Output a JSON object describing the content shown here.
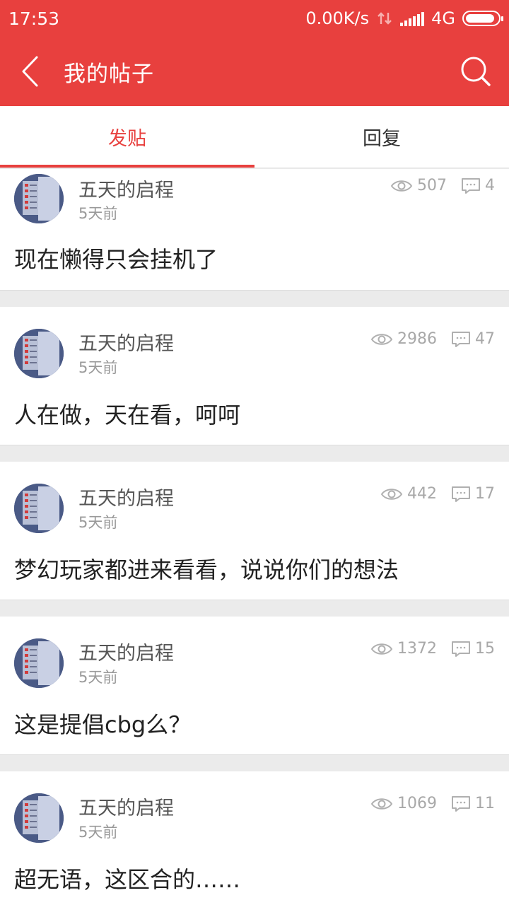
{
  "status_bar": {
    "time": "17:53",
    "net_speed": "0.00K/s",
    "network": "4G",
    "battery_level": 0.9
  },
  "header": {
    "back_icon": "chevron-left-icon",
    "title": "我的帖子",
    "search_icon": "search-icon",
    "background_color": "#e8403e"
  },
  "tabs": [
    {
      "label": "发贴",
      "active": true
    },
    {
      "label": "回复",
      "active": false
    }
  ],
  "posts": [
    {
      "author": "五天的启程",
      "time": "5天前",
      "views": "507",
      "comments": "4",
      "title": "现在懒得只会挂机了"
    },
    {
      "author": "五天的启程",
      "time": "5天前",
      "views": "2986",
      "comments": "47",
      "title": "人在做，天在看，呵呵"
    },
    {
      "author": "五天的启程",
      "time": "5天前",
      "views": "442",
      "comments": "17",
      "title": "梦幻玩家都进来看看，说说你们的想法"
    },
    {
      "author": "五天的启程",
      "time": "5天前",
      "views": "1372",
      "comments": "15",
      "title": "这是提倡cbg么？"
    },
    {
      "author": "五天的启程",
      "time": "5天前",
      "views": "1069",
      "comments": "11",
      "title": "超无语，这区合的……"
    }
  ],
  "colors": {
    "accent": "#e8403e",
    "meta": "#a8a8a8",
    "text": "#222222"
  }
}
